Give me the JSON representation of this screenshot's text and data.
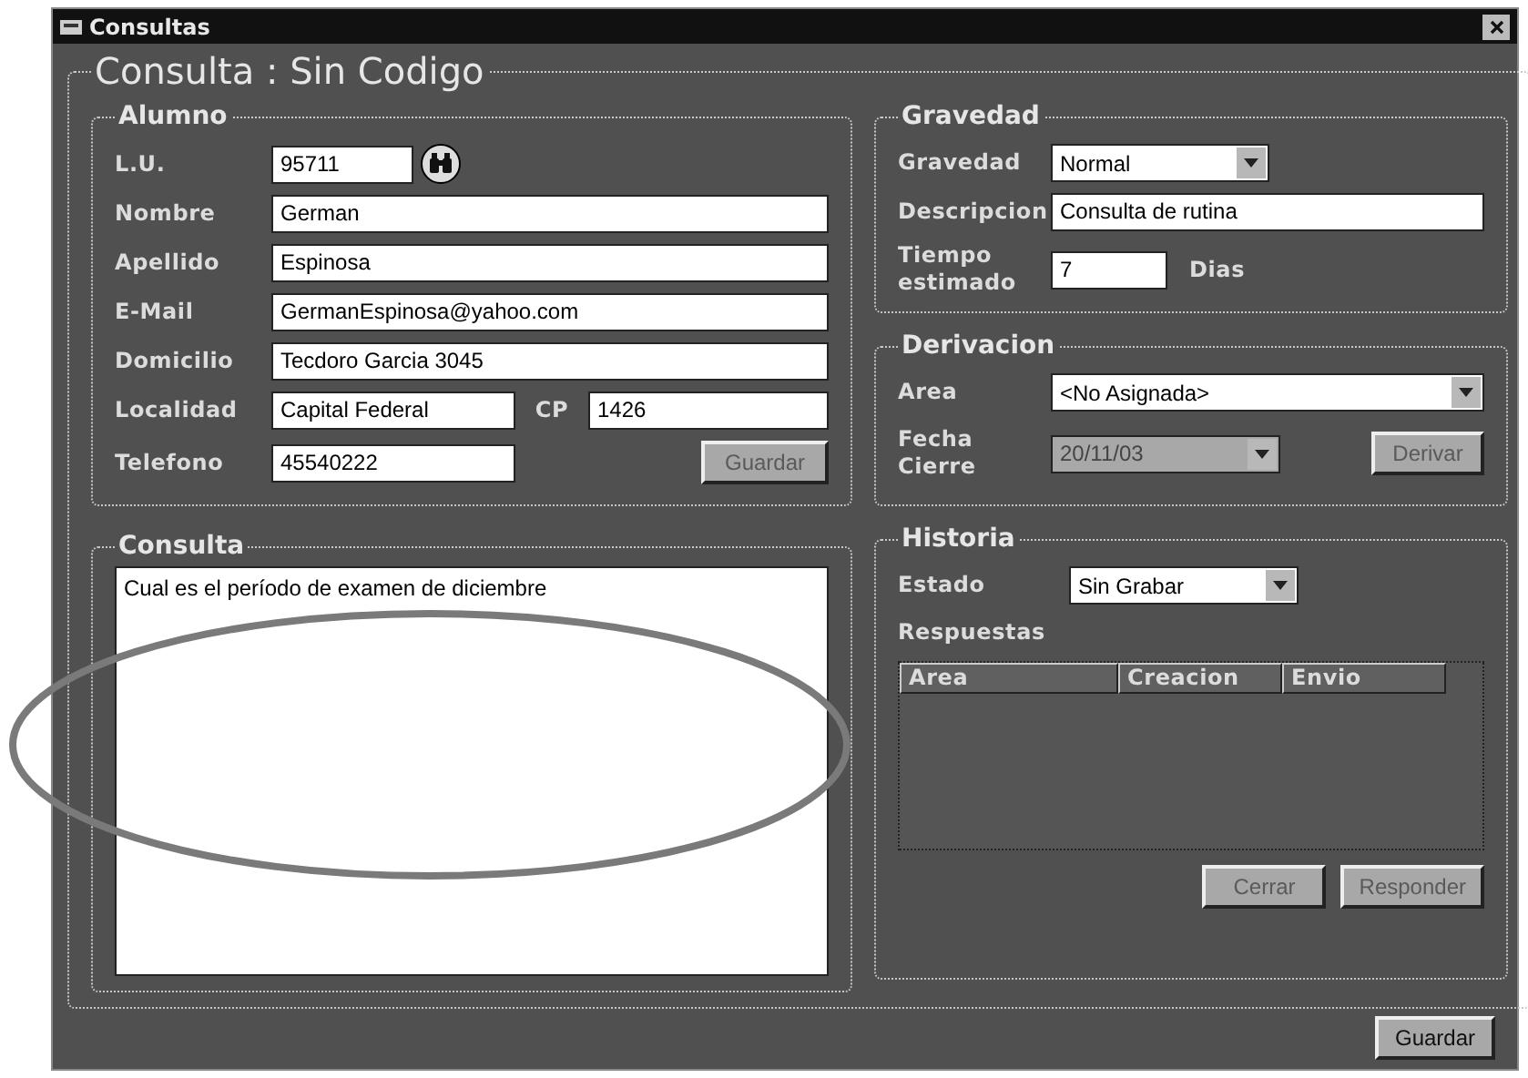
{
  "window": {
    "title": "Consultas"
  },
  "form_title": "Consulta : Sin Codigo",
  "alumno": {
    "title": "Alumno",
    "fields": [
      {
        "kind": "lu",
        "label": "L.U.",
        "value": "95711"
      },
      {
        "kind": "full",
        "label": "Nombre",
        "value": "German"
      },
      {
        "kind": "full",
        "label": "Apellido",
        "value": "Espinosa"
      },
      {
        "kind": "full",
        "label": "E-Mail",
        "value": "GermanEspinosa@yahoo.com"
      },
      {
        "kind": "full",
        "label": "Domicilio",
        "value": "Tecdoro Garcia 3045"
      },
      {
        "kind": "split",
        "label": "Localidad",
        "value": "Capital Federal",
        "extra_label": "CP",
        "extra_value": "1426"
      },
      {
        "kind": "phone",
        "label": "Telefono",
        "value": "45540222"
      }
    ],
    "button": {
      "label": "Guardar",
      "disabled": true
    }
  },
  "gravedad": {
    "title": "Gravedad",
    "fields": [
      {
        "kind": "select",
        "label": "Gravedad",
        "value": "Normal"
      },
      {
        "kind": "text",
        "label": "Descripcion",
        "value": "Consulta de rutina"
      },
      {
        "kind": "number",
        "label": "Tiempo estimado",
        "value": "7",
        "unit": "Dias"
      }
    ]
  },
  "derivacion": {
    "title": "Derivacion",
    "area": {
      "label": "Area",
      "value": "<No Asignada>"
    },
    "fecha": {
      "label": "Fecha Cierre",
      "value": "20/11/03",
      "disabled": true
    },
    "button": {
      "label": "Derivar",
      "disabled": true
    }
  },
  "consulta": {
    "title": "Consulta",
    "text": "Cual es el período de examen de diciembre"
  },
  "historia": {
    "title": "Historia",
    "estado": {
      "label": "Estado",
      "value": "Sin Grabar"
    },
    "respuestas": {
      "label": "Respuestas",
      "columns": [
        "Area",
        "Creacion",
        "Envio"
      ]
    },
    "buttons": [
      {
        "label": "Cerrar",
        "disabled": true
      },
      {
        "label": "Responder",
        "disabled": true
      }
    ]
  },
  "footer_button": {
    "label": "Guardar",
    "disabled": false
  }
}
